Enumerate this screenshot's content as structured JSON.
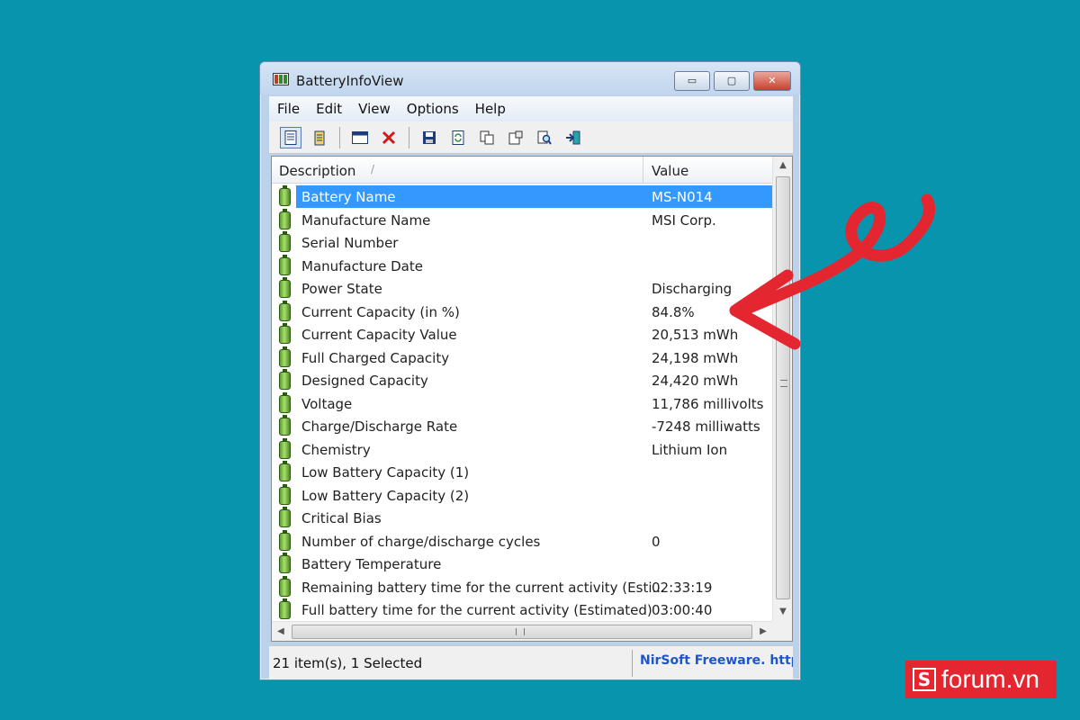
{
  "window": {
    "title": "BatteryInfoView",
    "buttons": {
      "minimize": "▭",
      "maximize": "▢",
      "close": "✕"
    }
  },
  "menu": [
    "File",
    "Edit",
    "View",
    "Options",
    "Help"
  ],
  "toolbar": {
    "icons": [
      "properties-icon",
      "battery-log-icon",
      "window-icon",
      "delete-icon",
      "save-icon",
      "refresh-icon",
      "copy-icon",
      "html-report-icon",
      "find-icon",
      "exit-icon"
    ]
  },
  "table": {
    "columns": {
      "description": "Description",
      "sort_marker": "/",
      "value": "Value"
    },
    "rows": [
      {
        "description": "Battery Name",
        "value": "MS-N014",
        "selected": true
      },
      {
        "description": "Manufacture Name",
        "value": "MSI Corp."
      },
      {
        "description": "Serial Number",
        "value": ""
      },
      {
        "description": "Manufacture Date",
        "value": ""
      },
      {
        "description": "Power State",
        "value": "Discharging"
      },
      {
        "description": "Current Capacity (in %)",
        "value": "84.8%"
      },
      {
        "description": "Current Capacity Value",
        "value": "20,513 mWh"
      },
      {
        "description": "Full Charged Capacity",
        "value": "24,198 mWh"
      },
      {
        "description": "Designed Capacity",
        "value": "24,420 mWh"
      },
      {
        "description": "Voltage",
        "value": "11,786 millivolts"
      },
      {
        "description": "Charge/Discharge Rate",
        "value": "-7248 milliwatts"
      },
      {
        "description": "Chemistry",
        "value": "Lithium Ion"
      },
      {
        "description": "Low Battery Capacity (1)",
        "value": ""
      },
      {
        "description": "Low Battery Capacity (2)",
        "value": ""
      },
      {
        "description": "Critical Bias",
        "value": ""
      },
      {
        "description": "Number of charge/discharge cycles",
        "value": "0"
      },
      {
        "description": "Battery Temperature",
        "value": ""
      },
      {
        "description": "Remaining battery time for the current activity (Esti...",
        "value": "02:33:19"
      },
      {
        "description": "Full battery time for the current activity (Estimated)",
        "value": "03:00:40"
      }
    ]
  },
  "scrollbar": {
    "up": "▲",
    "down": "▼",
    "left": "◀",
    "right": "▶"
  },
  "status": {
    "items": "21 item(s), 1 Selected",
    "credit": "NirSoft Freeware.  http"
  },
  "brand": {
    "mark": "S",
    "text": "forum.vn"
  },
  "colors": {
    "background": "#0994ad",
    "selection": "#3399ff",
    "annotation_arrow": "#e3262f",
    "brand": "#e3262f",
    "link": "#1e55c9"
  }
}
